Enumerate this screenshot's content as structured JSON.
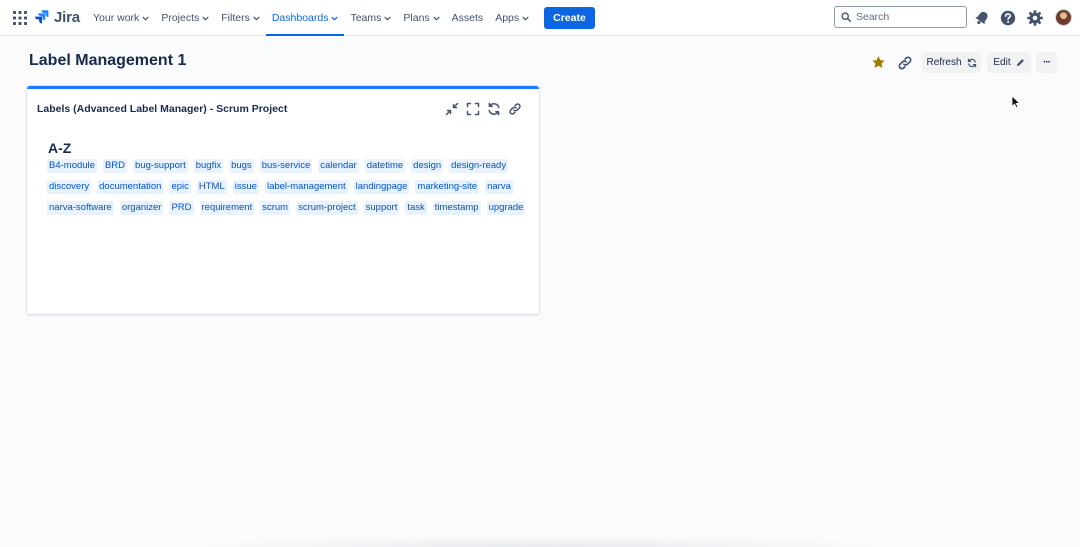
{
  "topnav": {
    "product_name": "Jira",
    "items": [
      {
        "label": "Your work",
        "dropdown": true,
        "active": false
      },
      {
        "label": "Projects",
        "dropdown": true,
        "active": false
      },
      {
        "label": "Filters",
        "dropdown": true,
        "active": false
      },
      {
        "label": "Dashboards",
        "dropdown": true,
        "active": true
      },
      {
        "label": "Teams",
        "dropdown": true,
        "active": false
      },
      {
        "label": "Plans",
        "dropdown": true,
        "active": false
      },
      {
        "label": "Assets",
        "dropdown": false,
        "active": false
      },
      {
        "label": "Apps",
        "dropdown": true,
        "active": false
      }
    ],
    "create_label": "Create",
    "search_placeholder": "Search",
    "icons": [
      "app-switcher-icon",
      "notifications-icon",
      "help-icon",
      "settings-icon"
    ]
  },
  "page": {
    "title": "Label Management 1",
    "refresh_label": "Refresh",
    "edit_label": "Edit",
    "more_label": "···"
  },
  "gadget": {
    "title": "Labels (Advanced Label Manager) - Scrum Project",
    "section_heading": "A-Z",
    "labels": [
      "B4-module",
      "BRD",
      "bug-support",
      "bugfix",
      "bugs",
      "bus-service",
      "calendar",
      "datetime",
      "design",
      "design-ready",
      "discovery",
      "documentation",
      "epic",
      "HTML",
      "issue",
      "label-management",
      "landingpage",
      "marketing-site",
      "narva",
      "narva-software",
      "organizer",
      "PRD",
      "requirement",
      "scrum",
      "scrum-project",
      "support",
      "task",
      "timestamp",
      "upgrade"
    ]
  },
  "colors": {
    "primary": "#0c66e4",
    "gadget_accent": "#1d7afc",
    "label_bg": "#e9f2ff",
    "label_text": "#0055cc",
    "star": "#a37b00"
  }
}
